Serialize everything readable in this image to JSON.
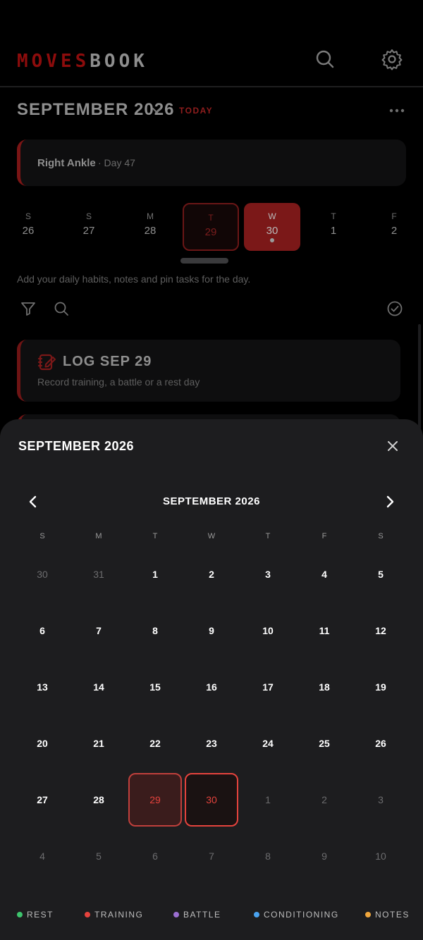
{
  "header": {
    "logo_part1": "MOVES",
    "logo_part2": "BOOK",
    "search_icon": "search-icon",
    "settings_icon": "gear-icon"
  },
  "month_bar": {
    "title": "SEPTEMBER 2026",
    "today_label": "TODAY"
  },
  "injury": {
    "name": "Right Ankle",
    "day": "· Day 47",
    "accent": "#7a1515"
  },
  "week": [
    {
      "dn": "S",
      "dd": "26",
      "state": "normal"
    },
    {
      "dn": "S",
      "dd": "27",
      "state": "normal"
    },
    {
      "dn": "M",
      "dd": "28",
      "state": "normal"
    },
    {
      "dn": "T",
      "dd": "29",
      "state": "today"
    },
    {
      "dn": "W",
      "dd": "30",
      "state": "selected",
      "dot": true
    },
    {
      "dn": "T",
      "dd": "1",
      "state": "normal"
    },
    {
      "dn": "F",
      "dd": "2",
      "state": "normal"
    }
  ],
  "hint": "Add your daily habits, notes and pin tasks for the day.",
  "log_card": {
    "title": "LOG SEP 29",
    "subtitle": "Record training, a battle or a rest day"
  },
  "sheet": {
    "title": "SEPTEMBER 2026",
    "calendar_title": "SEPTEMBER 2026",
    "weekdays": [
      "S",
      "M",
      "T",
      "W",
      "T",
      "F",
      "S"
    ],
    "weeks": [
      [
        {
          "d": "30",
          "m": true
        },
        {
          "d": "31",
          "m": true
        },
        {
          "d": "1"
        },
        {
          "d": "2"
        },
        {
          "d": "3"
        },
        {
          "d": "4"
        },
        {
          "d": "5"
        }
      ],
      [
        {
          "d": "6"
        },
        {
          "d": "7"
        },
        {
          "d": "8"
        },
        {
          "d": "9"
        },
        {
          "d": "10"
        },
        {
          "d": "11"
        },
        {
          "d": "12"
        }
      ],
      [
        {
          "d": "13"
        },
        {
          "d": "14"
        },
        {
          "d": "15"
        },
        {
          "d": "16"
        },
        {
          "d": "17"
        },
        {
          "d": "18"
        },
        {
          "d": "19"
        }
      ],
      [
        {
          "d": "20"
        },
        {
          "d": "21"
        },
        {
          "d": "22"
        },
        {
          "d": "23"
        },
        {
          "d": "24"
        },
        {
          "d": "25"
        },
        {
          "d": "26"
        }
      ],
      [
        {
          "d": "27"
        },
        {
          "d": "28"
        },
        {
          "d": "29",
          "s": "today"
        },
        {
          "d": "30",
          "s": "selected"
        },
        {
          "d": "1",
          "m": true
        },
        {
          "d": "2",
          "m": true
        },
        {
          "d": "3",
          "m": true
        }
      ],
      [
        {
          "d": "4",
          "m": true
        },
        {
          "d": "5",
          "m": true
        },
        {
          "d": "6",
          "m": true
        },
        {
          "d": "7",
          "m": true
        },
        {
          "d": "8",
          "m": true
        },
        {
          "d": "9",
          "m": true
        },
        {
          "d": "10",
          "m": true
        }
      ]
    ]
  },
  "legend": [
    {
      "label": "REST",
      "color": "#3ec46d"
    },
    {
      "label": "TRAINING",
      "color": "#e5433d"
    },
    {
      "label": "BATTLE",
      "color": "#9b6fd1"
    },
    {
      "label": "CONDITIONING",
      "color": "#4aa3f0"
    },
    {
      "label": "NOTES",
      "color": "#f0a63c"
    }
  ]
}
